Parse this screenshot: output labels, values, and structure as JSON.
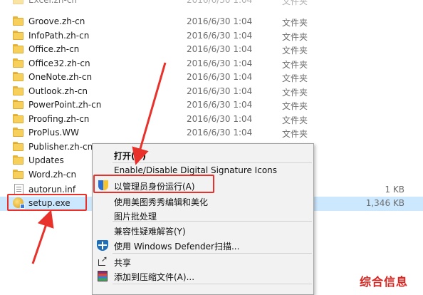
{
  "files": [
    {
      "name": "Excel.zh-cn",
      "date": "2016/6/30 1:04",
      "type": "文件夹",
      "size": "",
      "icon": "folder-icon",
      "partial": true
    },
    {
      "name": "Groove.zh-cn",
      "date": "2016/6/30 1:04",
      "type": "文件夹",
      "size": "",
      "icon": "folder-icon"
    },
    {
      "name": "InfoPath.zh-cn",
      "date": "2016/6/30 1:04",
      "type": "文件夹",
      "size": "",
      "icon": "folder-icon"
    },
    {
      "name": "Office.zh-cn",
      "date": "2016/6/30 1:04",
      "type": "文件夹",
      "size": "",
      "icon": "folder-icon"
    },
    {
      "name": "Office32.zh-cn",
      "date": "2016/6/30 1:04",
      "type": "文件夹",
      "size": "",
      "icon": "folder-icon"
    },
    {
      "name": "OneNote.zh-cn",
      "date": "2016/6/30 1:04",
      "type": "文件夹",
      "size": "",
      "icon": "folder-icon"
    },
    {
      "name": "Outlook.zh-cn",
      "date": "2016/6/30 1:04",
      "type": "文件夹",
      "size": "",
      "icon": "folder-icon"
    },
    {
      "name": "PowerPoint.zh-cn",
      "date": "2016/6/30 1:04",
      "type": "文件夹",
      "size": "",
      "icon": "folder-icon"
    },
    {
      "name": "Proofing.zh-cn",
      "date": "2016/6/30 1:04",
      "type": "文件夹",
      "size": "",
      "icon": "folder-icon"
    },
    {
      "name": "ProPlus.WW",
      "date": "2016/6/30 1:04",
      "type": "文件夹",
      "size": "",
      "icon": "folder-icon"
    },
    {
      "name": "Publisher.zh-cn",
      "date": "",
      "type": "",
      "size": "",
      "icon": "folder-icon"
    },
    {
      "name": "Updates",
      "date": "",
      "type": "",
      "size": "",
      "icon": "folder-icon"
    },
    {
      "name": "Word.zh-cn",
      "date": "",
      "type": "",
      "size": "",
      "icon": "folder-icon"
    },
    {
      "name": "autorun.inf",
      "date": "",
      "type": "",
      "size": "1 KB",
      "icon": "inf-icon"
    },
    {
      "name": "setup.exe",
      "date": "",
      "type": "",
      "size": "1,346 KB",
      "icon": "setup-icon",
      "selected": true
    }
  ],
  "context_menu": {
    "items": [
      {
        "label": "打开(O)",
        "icon": "",
        "bold": true
      },
      {
        "label": "Enable/Disable Digital Signature Icons",
        "icon": ""
      },
      {
        "label": "以管理员身份运行(A)",
        "icon": "shield-icon",
        "highlighted": true
      },
      {
        "label": "使用美图秀秀编辑和美化",
        "icon": ""
      },
      {
        "label": "图片批处理",
        "icon": ""
      },
      {
        "label": "兼容性疑难解答(Y)",
        "icon": ""
      },
      {
        "label": "使用 Windows Defender扫描...",
        "icon": "defender-icon"
      },
      {
        "label": "共享",
        "icon": "share-icon"
      },
      {
        "label": "添加到压缩文件(A)...",
        "icon": "archive-icon"
      }
    ]
  },
  "watermark": "综合信息",
  "colors": {
    "annotation": "#e8312b",
    "selection": "#cce8ff"
  }
}
